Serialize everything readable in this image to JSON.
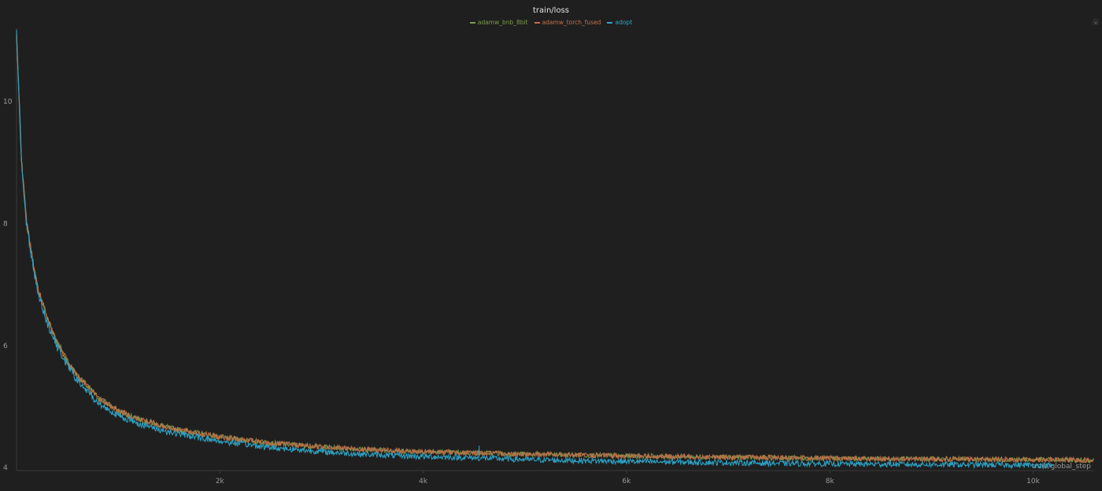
{
  "chart_data": {
    "type": "line",
    "title": "train/loss",
    "xlabel": "train/global_step",
    "ylabel": "",
    "xlim": [
      0,
      10600
    ],
    "ylim": [
      3.95,
      11.2
    ],
    "grid": false,
    "legend_position": "top-center",
    "x_ticks": [
      {
        "value": 2000,
        "label": "2k"
      },
      {
        "value": 4000,
        "label": "4k"
      },
      {
        "value": 6000,
        "label": "6k"
      },
      {
        "value": 8000,
        "label": "8k"
      },
      {
        "value": 10000,
        "label": "10k"
      }
    ],
    "y_ticks": [
      {
        "value": 4,
        "label": "4"
      },
      {
        "value": 6,
        "label": "6"
      },
      {
        "value": 8,
        "label": "8"
      },
      {
        "value": 10,
        "label": "10"
      }
    ],
    "series": [
      {
        "name": "adamw_bnb_8bit",
        "color": "#7d9a4a",
        "x": [
          0,
          50,
          100,
          200,
          300,
          400,
          500,
          600,
          800,
          1000,
          1200,
          1500,
          2000,
          2500,
          3000,
          3500,
          4000,
          4500,
          5000,
          6000,
          7000,
          8000,
          9000,
          10000,
          10600
        ],
        "y": [
          11.1,
          9.0,
          8.0,
          7.0,
          6.45,
          6.05,
          5.75,
          5.5,
          5.15,
          4.93,
          4.8,
          4.65,
          4.5,
          4.4,
          4.34,
          4.29,
          4.26,
          4.24,
          4.22,
          4.19,
          4.17,
          4.15,
          4.14,
          4.13,
          4.12
        ],
        "noise": 0.04
      },
      {
        "name": "adamw_torch_fused",
        "color": "#c0704a",
        "x": [
          0,
          50,
          100,
          200,
          300,
          400,
          500,
          600,
          800,
          1000,
          1200,
          1500,
          2000,
          2500,
          3000,
          3500,
          4000,
          4500,
          5000,
          6000,
          7000,
          8000,
          9000,
          10000,
          10600
        ],
        "y": [
          11.1,
          9.0,
          8.0,
          7.0,
          6.45,
          6.05,
          5.75,
          5.5,
          5.15,
          4.93,
          4.8,
          4.65,
          4.5,
          4.4,
          4.34,
          4.29,
          4.26,
          4.24,
          4.22,
          4.19,
          4.17,
          4.15,
          4.14,
          4.13,
          4.12
        ],
        "noise": 0.04
      },
      {
        "name": "adopt",
        "color": "#2ea6c9",
        "x": [
          0,
          50,
          100,
          200,
          300,
          400,
          500,
          600,
          800,
          1000,
          1200,
          1500,
          2000,
          2500,
          3000,
          3500,
          4000,
          4500,
          5000,
          6000,
          7000,
          8000,
          9000,
          10000,
          10200
        ],
        "y": [
          11.2,
          9.0,
          7.95,
          6.95,
          6.38,
          5.98,
          5.68,
          5.42,
          5.06,
          4.85,
          4.72,
          4.58,
          4.43,
          4.33,
          4.26,
          4.21,
          4.18,
          4.16,
          4.13,
          4.1,
          4.08,
          4.06,
          4.05,
          4.04,
          4.03
        ],
        "noise": 0.045
      }
    ]
  },
  "panel": {
    "menu_icon": "chevron-down-icon",
    "menu_glyph": "⌄"
  }
}
